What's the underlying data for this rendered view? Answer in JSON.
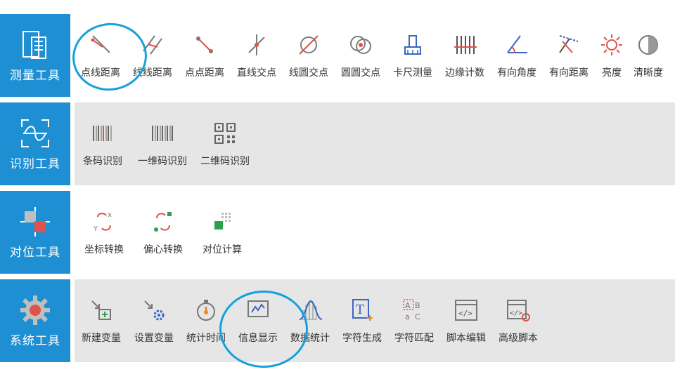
{
  "categories": [
    {
      "label": "测量工具",
      "tools": [
        "点线距离",
        "线线距离",
        "点点距离",
        "直线交点",
        "线圆交点",
        "圆圆交点",
        "卡尺测量",
        "边缘计数",
        "有向角度",
        "有向距离",
        "亮度",
        "清晰度"
      ]
    },
    {
      "label": "识别工具",
      "tools": [
        "条码识别",
        "一维码识别",
        "二维码识别"
      ]
    },
    {
      "label": "对位工具",
      "tools": [
        "坐标转换",
        "偏心转换",
        "对位计算"
      ]
    },
    {
      "label": "系统工具",
      "tools": [
        "新建变量",
        "设置变量",
        "统计时间",
        "信息显示",
        "数据统计",
        "字符生成",
        "字符匹配",
        "脚本编辑",
        "高级脚本"
      ]
    }
  ],
  "colors": {
    "category_bg": "#1f8fd4",
    "highlight_ring": "#16a0dc",
    "icon_red": "#e0524a",
    "icon_gray": "#7b7b7b"
  }
}
